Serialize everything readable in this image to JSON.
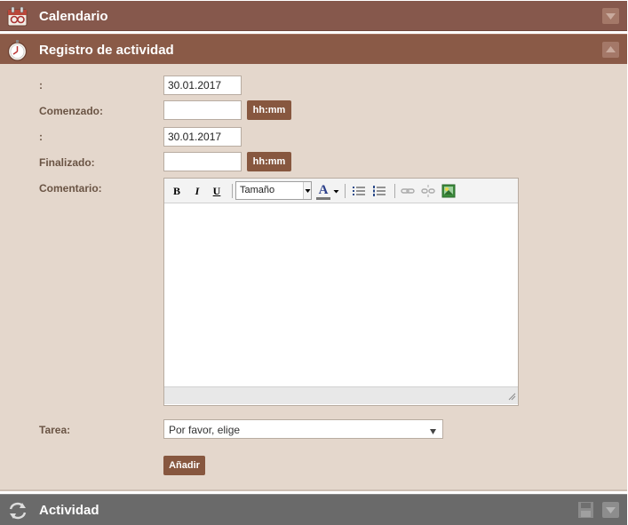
{
  "sections": {
    "calendar": {
      "title": "Calendario"
    },
    "activity_log": {
      "title": "Registro de actividad"
    },
    "activity": {
      "title": "Actividad"
    }
  },
  "form": {
    "start_date": {
      "label": ":",
      "value": "30.01.2017"
    },
    "started": {
      "label": "Comenzado:",
      "value": "",
      "time_button": "hh:mm"
    },
    "end_date": {
      "label": ":",
      "value": "30.01.2017"
    },
    "finished": {
      "label": "Finalizado:",
      "value": "",
      "time_button": "hh:mm"
    },
    "comment": {
      "label": "Comentario:",
      "toolbar": {
        "bold": "B",
        "italic": "I",
        "underline": "U",
        "size_select": "Tamaño",
        "font_color": "A"
      }
    },
    "task": {
      "label": "Tarea:",
      "selected": "Por favor, elige"
    },
    "add_button": "Añadir"
  },
  "colors": {
    "header_brown": "#8a5a47",
    "panel_bg": "#e4d7cc",
    "button_brown": "#87573f",
    "footer_gray": "#6a6a6a"
  }
}
